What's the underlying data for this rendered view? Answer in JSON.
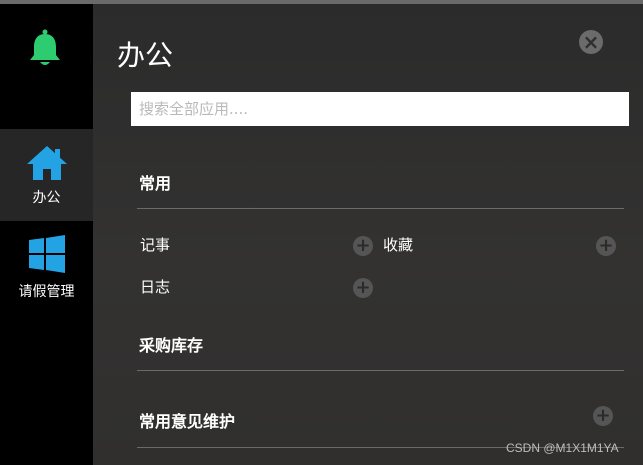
{
  "sidebar": {
    "items": [
      {
        "label": "办公",
        "icon": "home-icon"
      },
      {
        "label": "请假管理",
        "icon": "windows-icon"
      }
    ]
  },
  "panel": {
    "title": "办公",
    "close_icon": "×",
    "search_placeholder": "搜索全部应用...."
  },
  "sections": [
    {
      "name": "常用",
      "apps": [
        "记事",
        "收藏",
        "日志"
      ]
    },
    {
      "name": "采购库存"
    },
    {
      "name": "常用意见维护"
    }
  ],
  "plus_icon": "+",
  "watermark": "CSDN @M1X1M1YA",
  "colors": {
    "accent": "#23a3e3",
    "bell": "#2ecc71"
  }
}
